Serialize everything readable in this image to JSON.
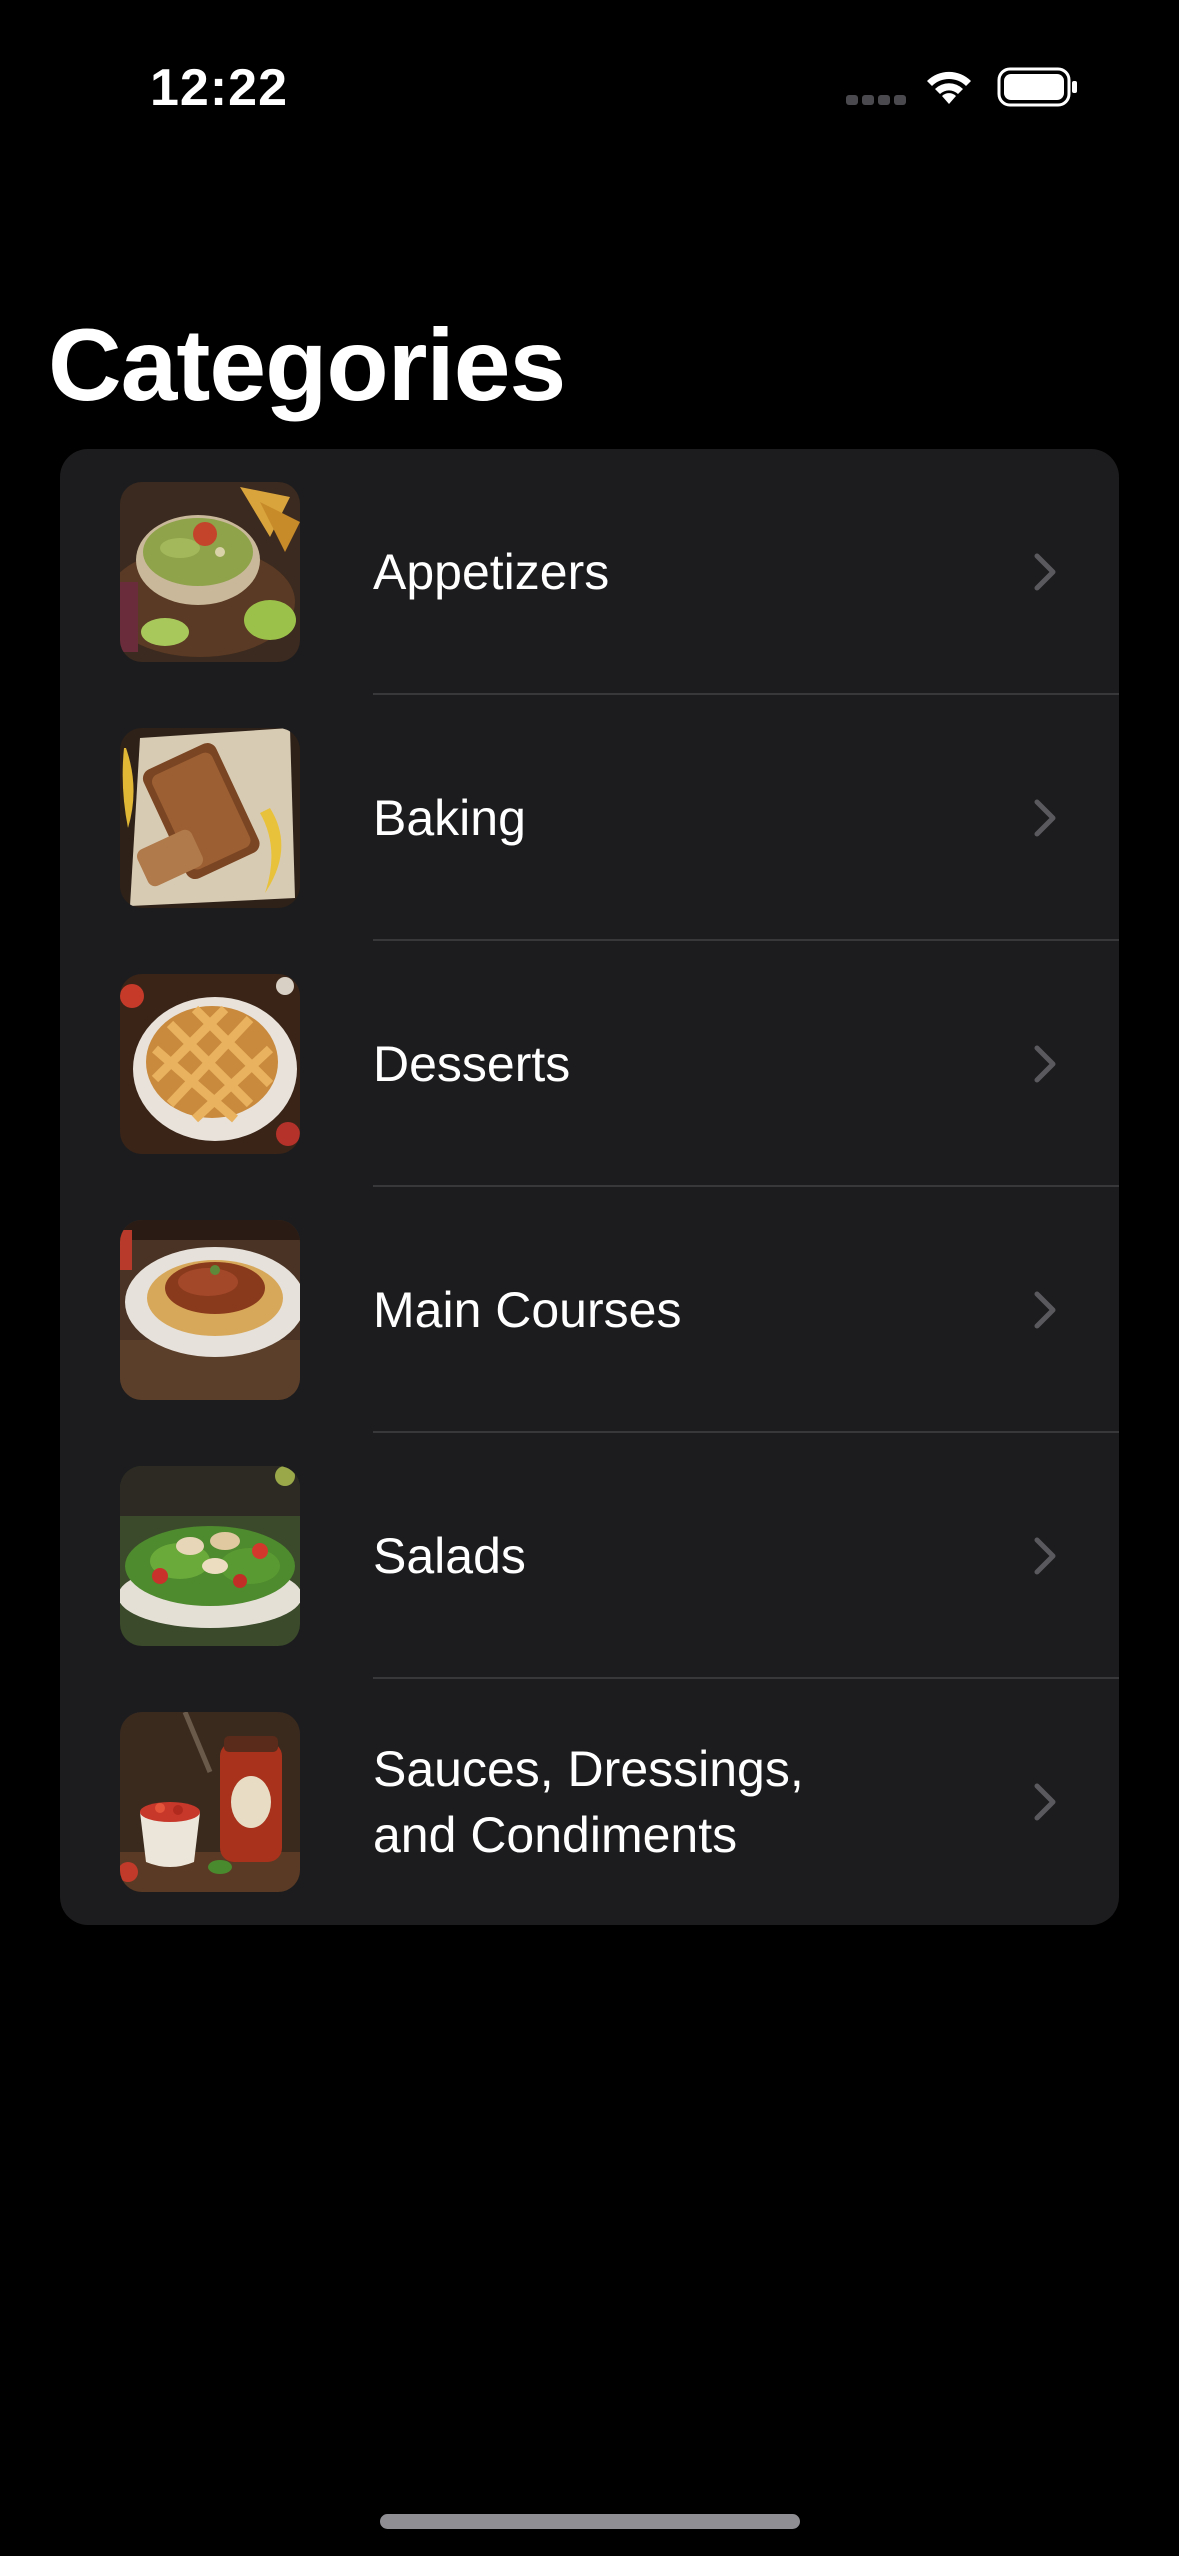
{
  "status_bar": {
    "time": "12:22",
    "signal_icon": "cellular-signal-icon",
    "wifi_icon": "wifi-icon",
    "battery_icon": "battery-icon"
  },
  "page": {
    "title": "Categories"
  },
  "categories": [
    {
      "label": "Appetizers",
      "image": "guacamole-bowl-photo"
    },
    {
      "label": "Baking",
      "image": "banana-bread-photo"
    },
    {
      "label": "Desserts",
      "image": "lattice-pie-photo"
    },
    {
      "label": "Main Courses",
      "image": "spaghetti-bolognese-photo"
    },
    {
      "label": "Salads",
      "image": "chicken-salad-photo"
    },
    {
      "label": "Sauces, Dressings, and Condiments",
      "image": "tomato-sauce-jar-photo"
    }
  ],
  "colors": {
    "background": "#000000",
    "list_background": "#1c1c1e",
    "separator": "#38383a",
    "chevron": "#5a5a5e",
    "text": "#ffffff"
  }
}
